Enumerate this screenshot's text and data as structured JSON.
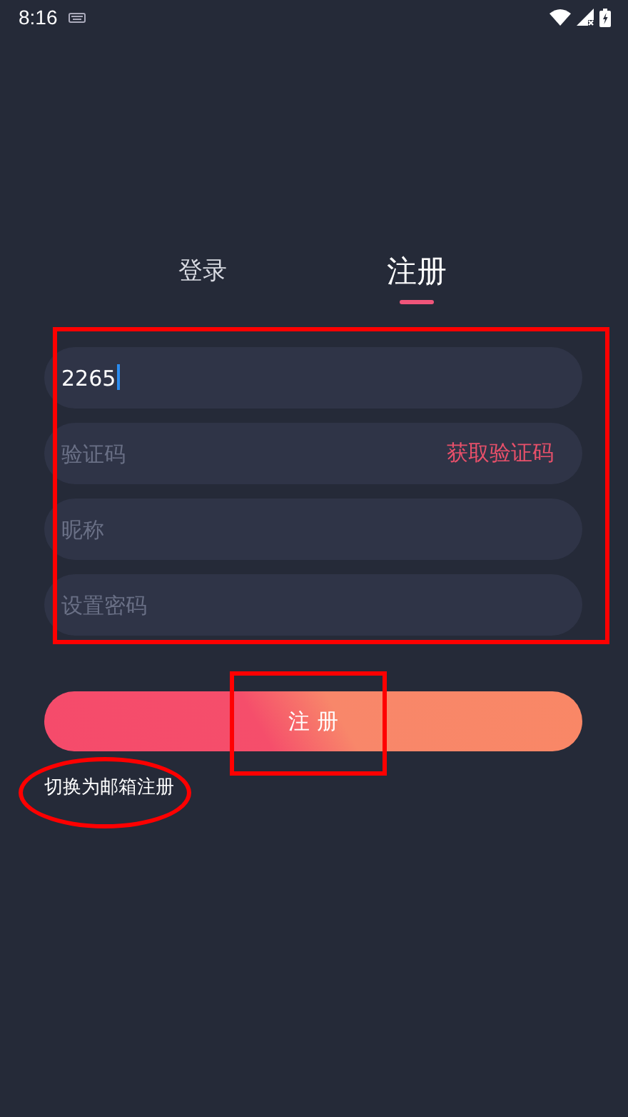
{
  "status_bar": {
    "time": "8:16"
  },
  "tabs": [
    {
      "label": "登录",
      "selected": false
    },
    {
      "label": "注册",
      "selected": true
    }
  ],
  "fields": [
    {
      "kind": "text",
      "value": "2265",
      "focused": true
    },
    {
      "kind": "code",
      "placeholder": "验证码",
      "action": "获取验证码"
    },
    {
      "kind": "text",
      "placeholder": "昵称"
    },
    {
      "kind": "password",
      "placeholder": "设置密码"
    }
  ],
  "submit_button": "注 册",
  "switch_link": "切换为邮箱注册"
}
